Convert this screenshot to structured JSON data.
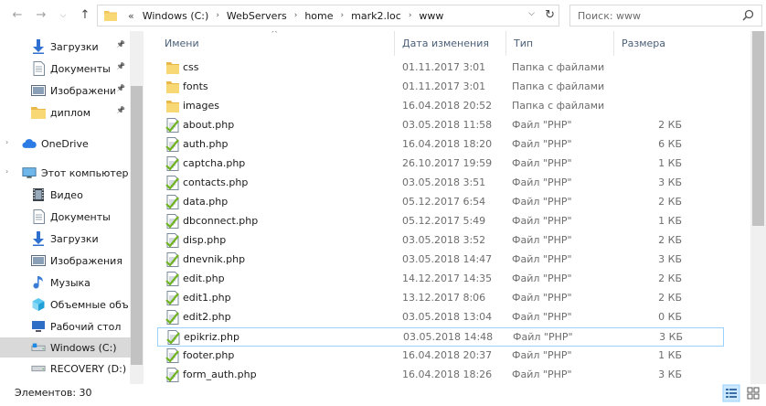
{
  "address_bar": {
    "overflow": "«",
    "crumbs": [
      "Windows (C:)",
      "WebServers",
      "home",
      "mark2.loc",
      "www"
    ]
  },
  "search": {
    "placeholder": "Поиск: www"
  },
  "sidebar": {
    "items": [
      {
        "label": "Загрузки",
        "icon": "download-arrow-icon",
        "pinned": true
      },
      {
        "label": "Документы",
        "icon": "document-icon",
        "pinned": true
      },
      {
        "label": "Изображени",
        "icon": "pictures-icon",
        "pinned": true
      },
      {
        "label": "диплом",
        "icon": "folder-icon",
        "pinned": true
      },
      {
        "label": "OneDrive",
        "icon": "cloud-icon",
        "pinned": false
      },
      {
        "label": "Этот компьютер",
        "icon": "computer-icon",
        "pinned": false
      },
      {
        "label": "Видео",
        "icon": "video-icon",
        "pinned": false
      },
      {
        "label": "Документы",
        "icon": "document-icon",
        "pinned": false
      },
      {
        "label": "Загрузки",
        "icon": "download-arrow-icon",
        "pinned": false
      },
      {
        "label": "Изображения",
        "icon": "pictures-icon",
        "pinned": false
      },
      {
        "label": "Музыка",
        "icon": "music-note-icon",
        "pinned": false
      },
      {
        "label": "Объемные объ",
        "icon": "3d-objects-icon",
        "pinned": false
      },
      {
        "label": "Рабочий стол",
        "icon": "desktop-icon",
        "pinned": false
      },
      {
        "label": "Windows (C:)",
        "icon": "windows-drive-icon",
        "pinned": false,
        "selected": true
      },
      {
        "label": "RECOVERY (D:)",
        "icon": "drive-icon",
        "pinned": false
      }
    ]
  },
  "columns": {
    "name": "Имени",
    "date": "Дата изменения",
    "type": "Тип",
    "size": "Размера"
  },
  "files": [
    {
      "name": "css",
      "date": "01.11.2017 3:01",
      "type": "Папка с файлами",
      "size": "",
      "kind": "folder"
    },
    {
      "name": "fonts",
      "date": "01.11.2017 3:01",
      "type": "Папка с файлами",
      "size": "",
      "kind": "folder"
    },
    {
      "name": "images",
      "date": "16.04.2018 20:52",
      "type": "Папка с файлами",
      "size": "",
      "kind": "folder"
    },
    {
      "name": "about.php",
      "date": "03.05.2018 11:58",
      "type": "Файл \"PHP\"",
      "size": "2 КБ",
      "kind": "php"
    },
    {
      "name": "auth.php",
      "date": "16.04.2018 18:20",
      "type": "Файл \"PHP\"",
      "size": "6 КБ",
      "kind": "php"
    },
    {
      "name": "captcha.php",
      "date": "26.10.2017 19:59",
      "type": "Файл \"PHP\"",
      "size": "1 КБ",
      "kind": "php"
    },
    {
      "name": "contacts.php",
      "date": "03.05.2018 3:51",
      "type": "Файл \"PHP\"",
      "size": "3 КБ",
      "kind": "php"
    },
    {
      "name": "data.php",
      "date": "05.12.2017 6:54",
      "type": "Файл \"PHP\"",
      "size": "2 КБ",
      "kind": "php"
    },
    {
      "name": "dbconnect.php",
      "date": "05.12.2017 5:49",
      "type": "Файл \"PHP\"",
      "size": "1 КБ",
      "kind": "php"
    },
    {
      "name": "disp.php",
      "date": "03.05.2018 3:52",
      "type": "Файл \"PHP\"",
      "size": "2 КБ",
      "kind": "php"
    },
    {
      "name": "dnevnik.php",
      "date": "03.05.2018 14:47",
      "type": "Файл \"PHP\"",
      "size": "3 КБ",
      "kind": "php"
    },
    {
      "name": "edit.php",
      "date": "14.12.2017 14:35",
      "type": "Файл \"PHP\"",
      "size": "2 КБ",
      "kind": "php"
    },
    {
      "name": "edit1.php",
      "date": "13.12.2017 8:06",
      "type": "Файл \"PHP\"",
      "size": "2 КБ",
      "kind": "php"
    },
    {
      "name": "edit2.php",
      "date": "03.05.2018 13:04",
      "type": "Файл \"PHP\"",
      "size": "0 КБ",
      "kind": "php"
    },
    {
      "name": "epikriz.php",
      "date": "03.05.2018 14:48",
      "type": "Файл \"PHP\"",
      "size": "3 КБ",
      "kind": "php",
      "highlighted": true
    },
    {
      "name": "footer.php",
      "date": "16.04.2018 20:37",
      "type": "Файл \"PHP\"",
      "size": "1 КБ",
      "kind": "php"
    },
    {
      "name": "form_auth.php",
      "date": "16.04.2018 18:26",
      "type": "Файл \"PHP\"",
      "size": "3 КБ",
      "kind": "php"
    }
  ],
  "status": {
    "items_count": "Элементов: 30"
  },
  "colors": {
    "header_text": "#4c607a",
    "selection": "#d9d9d9",
    "hover_border": "#99d1ff",
    "folder": "#f2c55c"
  }
}
